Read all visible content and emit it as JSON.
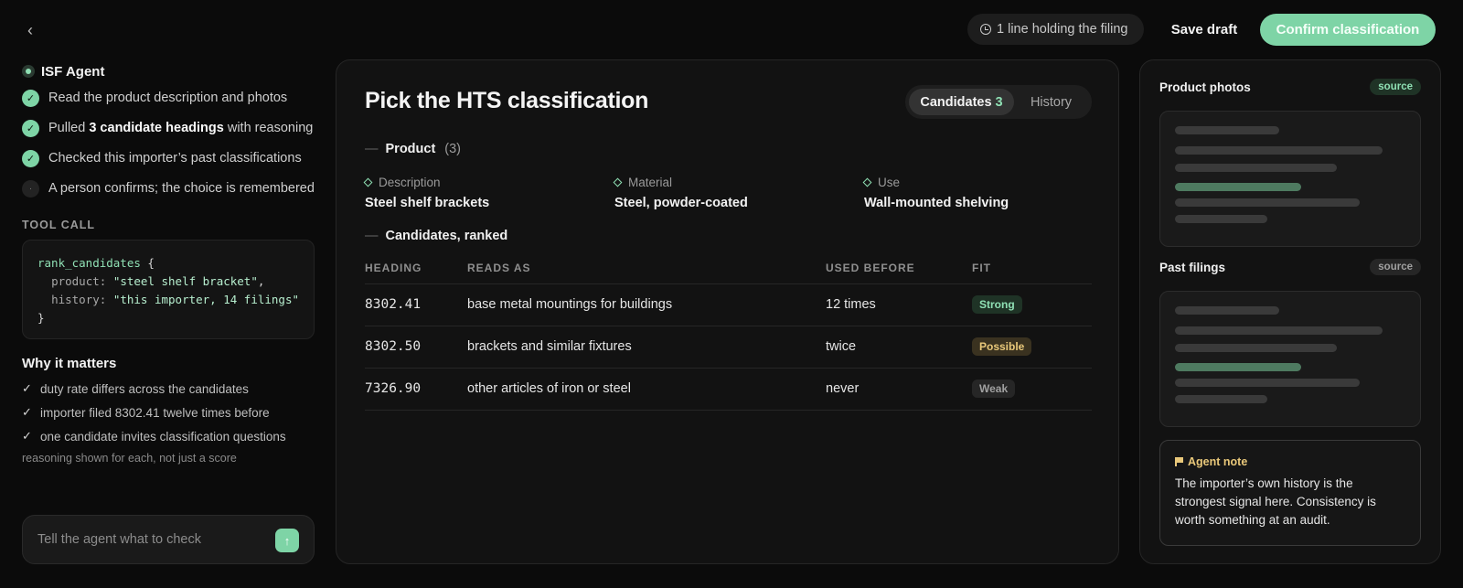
{
  "topbar": {
    "back_glyph": "‹",
    "holding_status": "1 line holding the filing",
    "save_draft": "Save draft",
    "confirm": "Confirm classification"
  },
  "agent": {
    "name": "ISF Agent",
    "steps": [
      {
        "status": "done",
        "text": "Read the product description and photos"
      },
      {
        "status": "done",
        "prefix": "Pulled ",
        "bold": "3 candidate headings",
        "suffix": " with reasoning"
      },
      {
        "status": "done",
        "text": "Checked this importer’s past classifications"
      },
      {
        "status": "pending",
        "text": "A person confirms; the choice is remembered"
      }
    ],
    "tool_call_label": "TOOL CALL",
    "tool_call": {
      "fn": "rank_candidates",
      "open": " {",
      "args": [
        {
          "key": "product",
          "value": "\"steel shelf bracket\"",
          "trail": ","
        },
        {
          "key": "history",
          "value": "\"this importer, 14 filings\"",
          "trail": ""
        }
      ],
      "close": "}"
    },
    "why_title": "Why it matters",
    "why_items": [
      "duty rate differs across the candidates",
      "importer filed 8302.41 twelve times before",
      "one candidate invites classification questions"
    ],
    "why_footnote": "reasoning shown for each, not just a score",
    "chat_placeholder": "Tell the agent what to check",
    "send_glyph": "↑"
  },
  "main": {
    "title": "Pick the HTS classification",
    "tabs": [
      {
        "label": "Candidates",
        "count": "3",
        "active": true
      },
      {
        "label": "History",
        "active": false
      }
    ],
    "product_section": {
      "label": "Product",
      "count": "(3)"
    },
    "attributes": [
      {
        "label": "Description",
        "value": "Steel shelf brackets"
      },
      {
        "label": "Material",
        "value": "Steel, powder-coated"
      },
      {
        "label": "Use",
        "value": "Wall-mounted shelving"
      }
    ],
    "candidates_section": {
      "label": "Candidates, ranked"
    },
    "table": {
      "columns": [
        "HEADING",
        "READS AS",
        "USED BEFORE",
        "FIT"
      ],
      "rows": [
        {
          "heading": "8302.41",
          "reads_as": "base metal mountings for buildings",
          "used_before": "12 times",
          "fit": "Strong",
          "fit_level": "strong"
        },
        {
          "heading": "8302.50",
          "reads_as": "brackets and similar fixtures",
          "used_before": "twice",
          "fit": "Possible",
          "fit_level": "possible"
        },
        {
          "heading": "7326.90",
          "reads_as": "other articles of iron or steel",
          "used_before": "never",
          "fit": "Weak",
          "fit_level": "weak"
        }
      ]
    }
  },
  "right": {
    "photos": {
      "title": "Product photos",
      "badge": "source"
    },
    "filings": {
      "title": "Past filings",
      "badge": "source"
    },
    "note": {
      "title": "Agent note",
      "text": "The importer’s own history is the strongest signal here. Consistency is worth something at an audit."
    }
  },
  "colors": {
    "accent": "#7ed4a6",
    "background": "#0b0b0b",
    "panel": "#121212",
    "warning": "#e9c87a"
  }
}
